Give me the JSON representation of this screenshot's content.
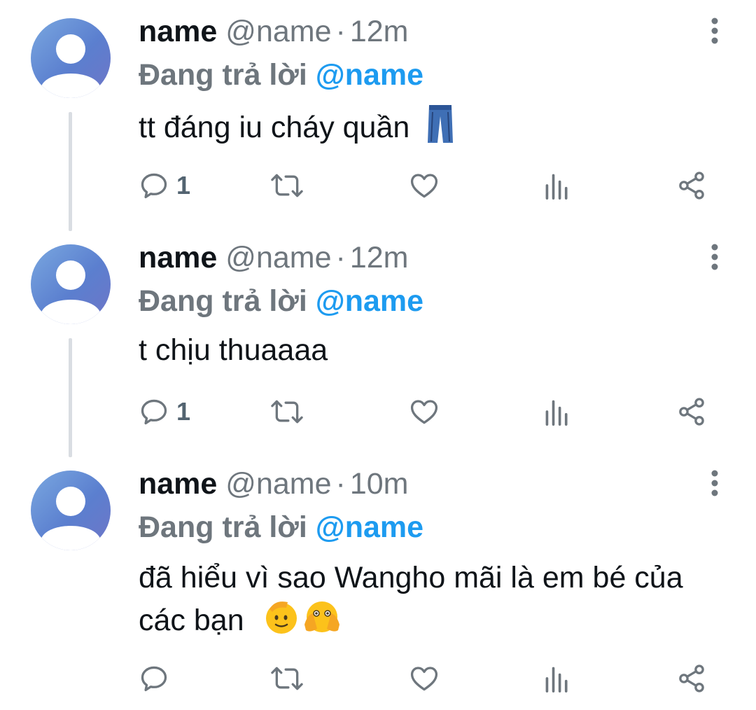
{
  "tweets": [
    {
      "name": "name",
      "handle": "@name",
      "separator": "·",
      "time": "12m",
      "replying_prefix": "Đang trả lời",
      "replying_to": "@name",
      "text": "tt đáng iu cháy quần",
      "emojis": [
        "jeans-emoji"
      ],
      "reply_count": "1"
    },
    {
      "name": "name",
      "handle": "@name",
      "separator": "·",
      "time": "12m",
      "replying_prefix": "Đang trả lời",
      "replying_to": "@name",
      "text": "t chịu thuaaaa",
      "emojis": [],
      "reply_count": "1"
    },
    {
      "name": "name",
      "handle": "@name",
      "separator": "·",
      "time": "10m",
      "replying_prefix": "Đang trả lời",
      "replying_to": "@name",
      "text": "đã hiểu vì sao Wangho mãi là em bé của các bạn",
      "emojis": [
        "saluting-face-emoji",
        "face-with-open-eyes-and-hand-over-mouth-emoji"
      ],
      "reply_count": ""
    }
  ],
  "icons": {
    "reply": "reply-icon",
    "retweet": "retweet-icon",
    "like": "like-heart-icon",
    "views": "views-bar-chart-icon",
    "share": "share-icon",
    "more": "more-vertical-icon"
  },
  "colors": {
    "mention": "#1d9bf0",
    "muted": "#6e767d",
    "text": "#0f1419",
    "thread_line": "#d9dde2"
  }
}
